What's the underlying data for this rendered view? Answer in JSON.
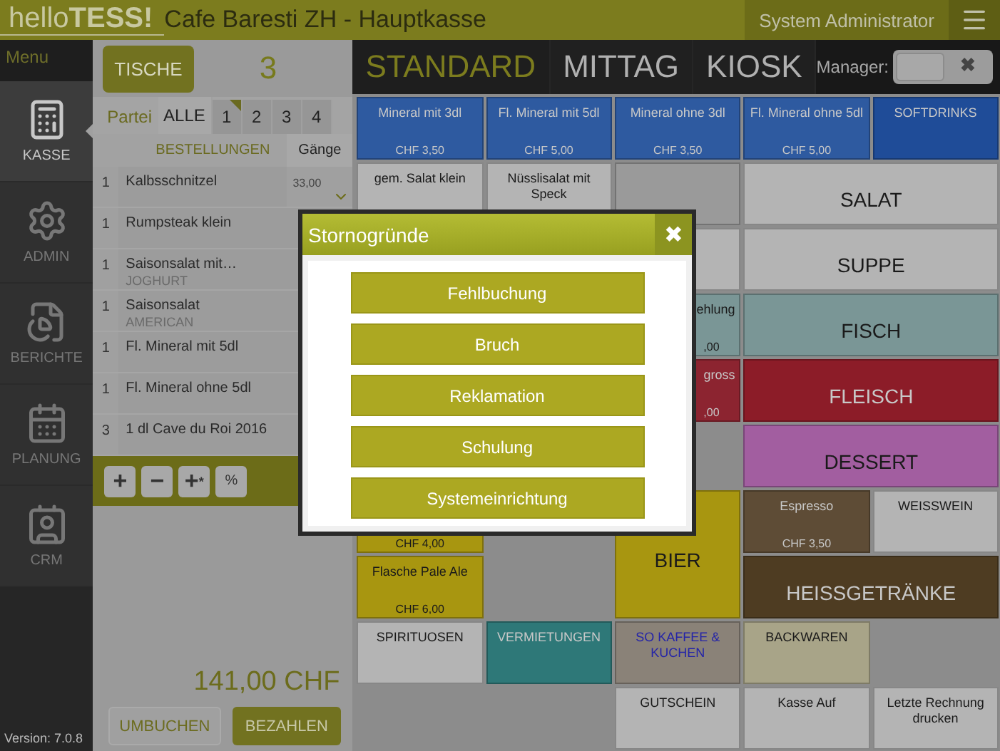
{
  "header": {
    "logo_light": "hello",
    "logo_bold": "TESS!",
    "title": "Cafe Baresti ZH - Hauptkasse",
    "user": "System Administrator"
  },
  "sidebar": {
    "title": "Menu",
    "items": [
      {
        "label": "KASSE",
        "selected": true
      },
      {
        "label": "ADMIN",
        "selected": false
      },
      {
        "label": "BERICHTE",
        "selected": false
      },
      {
        "label": "PLANUNG",
        "selected": false
      },
      {
        "label": "CRM",
        "selected": false
      }
    ],
    "version": "Version: 7.0.8"
  },
  "order": {
    "tables_button": "TISCHE",
    "table_number": "3",
    "party_label": "Partei",
    "parties": [
      {
        "label": "ALLE",
        "selected": true,
        "flagged": false
      },
      {
        "label": "1",
        "selected": false,
        "flagged": true
      },
      {
        "label": "2",
        "selected": false,
        "flagged": false
      },
      {
        "label": "3",
        "selected": false,
        "flagged": false
      },
      {
        "label": "4",
        "selected": false,
        "flagged": false
      }
    ],
    "columns": [
      "BESTELLUNGEN",
      "Gänge"
    ],
    "rows": [
      {
        "qty": "1",
        "name": "Kalbsschnitzel",
        "price": "33,00"
      },
      {
        "qty": "1",
        "name": "Rumpsteak klein"
      },
      {
        "qty": "1",
        "name": "Saisonsalat mit…",
        "note": "JOGHURT"
      },
      {
        "qty": "1",
        "name": "Saisonsalat",
        "note": "AMERICAN"
      },
      {
        "qty": "1",
        "name": "Fl. Mineral mit 5dl"
      },
      {
        "qty": "1",
        "name": "Fl. Mineral ohne 5dl"
      },
      {
        "qty": "3",
        "name": "1 dl Cave du Roi 2016"
      }
    ],
    "tools": [
      {
        "symbol": "+"
      },
      {
        "symbol": "−"
      },
      {
        "symbol": "+",
        "sub": "*"
      },
      {
        "symbol": "%"
      }
    ],
    "total": "141,00 CHF",
    "buttons": [
      {
        "label": "UMBUCHEN",
        "kind": "plain"
      },
      {
        "label": "BEZAHLEN",
        "kind": "primary"
      }
    ]
  },
  "categories": [
    {
      "label": "STANDARD",
      "selected": true
    },
    {
      "label": "MITTAG",
      "selected": false
    },
    {
      "label": "KIOSK",
      "selected": false
    }
  ],
  "manager": {
    "label": "Manager:",
    "on": false,
    "off_mark": "✖"
  },
  "tiles": [
    {
      "kind": "plain",
      "label": "Mineral mit 3dl",
      "price": "CHF 3,50",
      "color": "#2e5aa0"
    },
    {
      "kind": "plain",
      "label": "Fl. Mineral mit 5dl",
      "price": "CHF 5,00",
      "color": "#2e5aa0"
    },
    {
      "kind": "plain",
      "label": "Mineral ohne 3dl",
      "price": "CHF 3,50",
      "color": "#2e5aa0"
    },
    {
      "kind": "plain",
      "label": "Fl. Mineral ohne 5dl",
      "price": "CHF 5,00",
      "color": "#2e5aa0"
    },
    {
      "kind": "plain",
      "label": "SOFTDRINKS",
      "color": "#1f4c98"
    },
    {
      "kind": "plain",
      "label": "gem. Salat klein",
      "color": "#b4b4b4"
    },
    {
      "kind": "plain",
      "label": "Nüsslisalat mit Speck",
      "color": "#b4b4b4"
    },
    {
      "kind": "plain",
      "color": "#9a9a9a"
    },
    {
      "kind": "plain",
      "label": "SALAT",
      "color": "#b4b4b4"
    },
    {
      "kind": "plain",
      "color": "#b4b4b4"
    },
    {
      "kind": "plain",
      "label": "SUPPE",
      "color": "#b4b4b4"
    },
    {
      "kind": "plain",
      "label": "ehlung",
      "price": ",00",
      "color": "#7a9696"
    },
    {
      "kind": "plain",
      "label": "FISCH",
      "color": "#7a9696"
    },
    {
      "kind": "plain",
      "label": "gross",
      "price": ",00",
      "color": "#8c2430"
    },
    {
      "kind": "plain",
      "label": "FLEISCH",
      "color": "#8c1c28"
    },
    {
      "kind": "plain",
      "label": "DESSERT",
      "color": "#a25ea0"
    },
    {
      "kind": "plain",
      "price": "CHF 4,00",
      "color": "#a89610"
    },
    {
      "kind": "plain",
      "label": "BIER",
      "color": "#a89610"
    },
    {
      "kind": "plain",
      "label": "Espresso",
      "price": "CHF 3,50",
      "color": "#5e4c36"
    },
    {
      "kind": "plain",
      "label": "WEISSWEIN",
      "color": "#b4b4b4"
    },
    {
      "kind": "plain",
      "label": "Flasche Pale Ale",
      "price": "CHF 6,00",
      "color": "#a89610"
    },
    {
      "kind": "plain",
      "label": "HEISSGETRÄNKE",
      "color": "#4e3c22"
    },
    {
      "kind": "plain",
      "label": "SPIRITUOSEN",
      "color": "#b4b4b4"
    },
    {
      "kind": "plain",
      "label": "VERMIETUNGEN",
      "color": "#2e7878"
    },
    {
      "kind": "accent",
      "label": "SO KAFFEE & KUCHEN",
      "color": "#8a8278"
    },
    {
      "kind": "plain",
      "label": "BACKWAREN",
      "color": "#a8a488"
    },
    {
      "kind": "plain",
      "label": "GUTSCHEIN",
      "color": "#b4b4b4"
    },
    {
      "kind": "plain",
      "label": "Kasse Auf",
      "color": "#b4b4b4"
    },
    {
      "kind": "plain",
      "label": "Letzte Rechnung drucken",
      "color": "#b4b4b4"
    }
  ],
  "dialog": {
    "title": "Stornogründe",
    "close": "✖",
    "options": [
      "Fehlbuchung",
      "Bruch",
      "Reklamation",
      "Schulung",
      "Systemeinrichtung"
    ]
  }
}
